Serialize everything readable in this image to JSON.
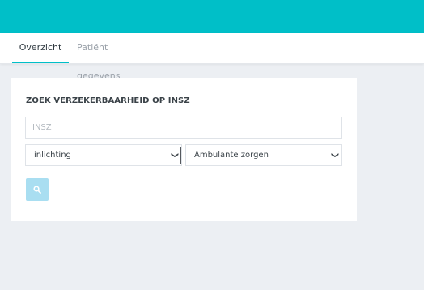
{
  "tabs": [
    {
      "label": "Overzicht",
      "active": true
    },
    {
      "label": "Patiënt gegevens",
      "active": false
    }
  ],
  "search_card": {
    "title": "ZOEK VERZEKERBAARHEID OP INSZ",
    "insz_placeholder": "INSZ",
    "insz_value": "",
    "request_type_selected": "inlichting",
    "care_type_selected": "Ambulante zorgen",
    "search_icon": "search-icon"
  },
  "colors": {
    "accent": "#00bfc8",
    "search_button": "#a9def1",
    "page_background": "#eceff3"
  }
}
